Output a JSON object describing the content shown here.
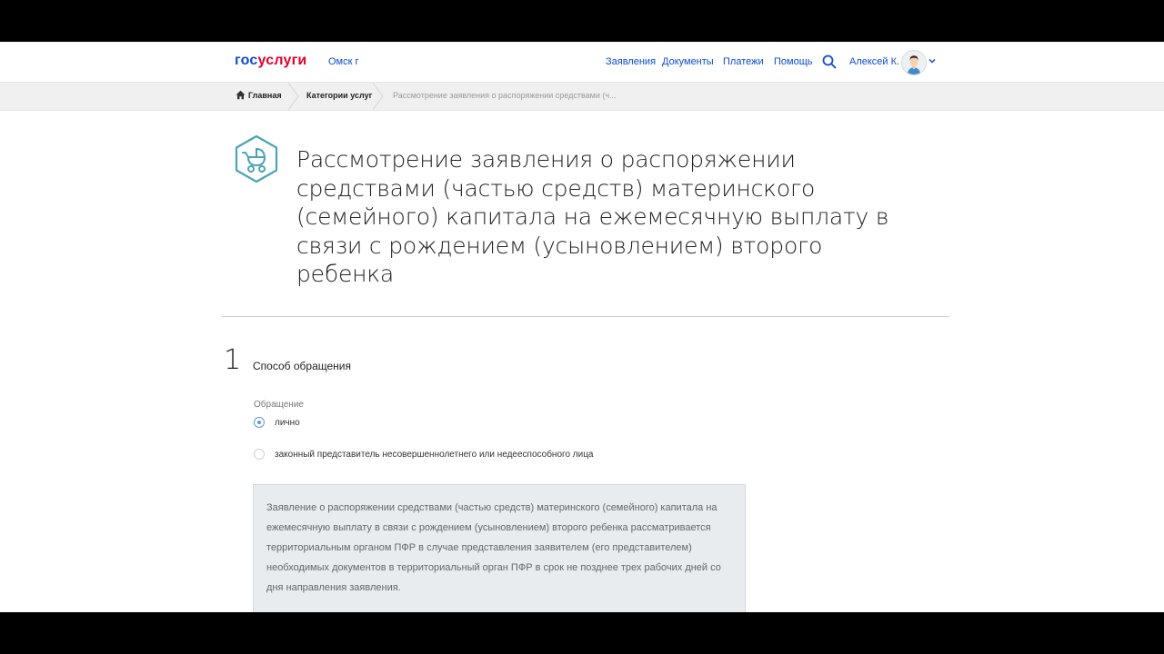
{
  "header": {
    "logo_part1": "гос",
    "logo_part2": "услуги",
    "city": "Омск г",
    "nav": [
      "Заявления",
      "Документы",
      "Платежи",
      "Помощь"
    ],
    "user_name": "Алексей К."
  },
  "breadcrumb": {
    "items": [
      "Главная",
      "Категории услуг",
      "Рассмотрение заявления о распоряжении средствами (ч..."
    ]
  },
  "page": {
    "title": "Рассмотрение заявления о распоряжении средствами (частью средств) материнского (семейного) капитала на ежемесячную выплату в связи с рождением (усыновлением) второго ребенка"
  },
  "step": {
    "number": "1",
    "title": "Способ обращения",
    "field_label": "Обращение",
    "options": [
      {
        "label": "лично",
        "selected": true
      },
      {
        "label": "законный представитель несовершеннолетнего или недееспособного лица",
        "selected": false
      }
    ],
    "info": "Заявление о распоряжении средствами (частью средств) материнского (семейного) капитала на ежемесячную выплату в связи с рождением (усыновлением) второго ребенка рассматривается территориальным органом ПФР в случае представления заявителем (его представителем) необходимых документов в территориальный орган ПФР в срок не позднее трех рабочих дней со дня направления заявления."
  },
  "colors": {
    "brand_blue": "#0d4cd3",
    "brand_red": "#e4002b",
    "icon_teal": "#4aa3b8",
    "radio_blue": "#5b9bd5"
  },
  "icons": [
    "search-icon",
    "home-icon",
    "chevron-down-icon",
    "stroller-icon",
    "avatar"
  ]
}
